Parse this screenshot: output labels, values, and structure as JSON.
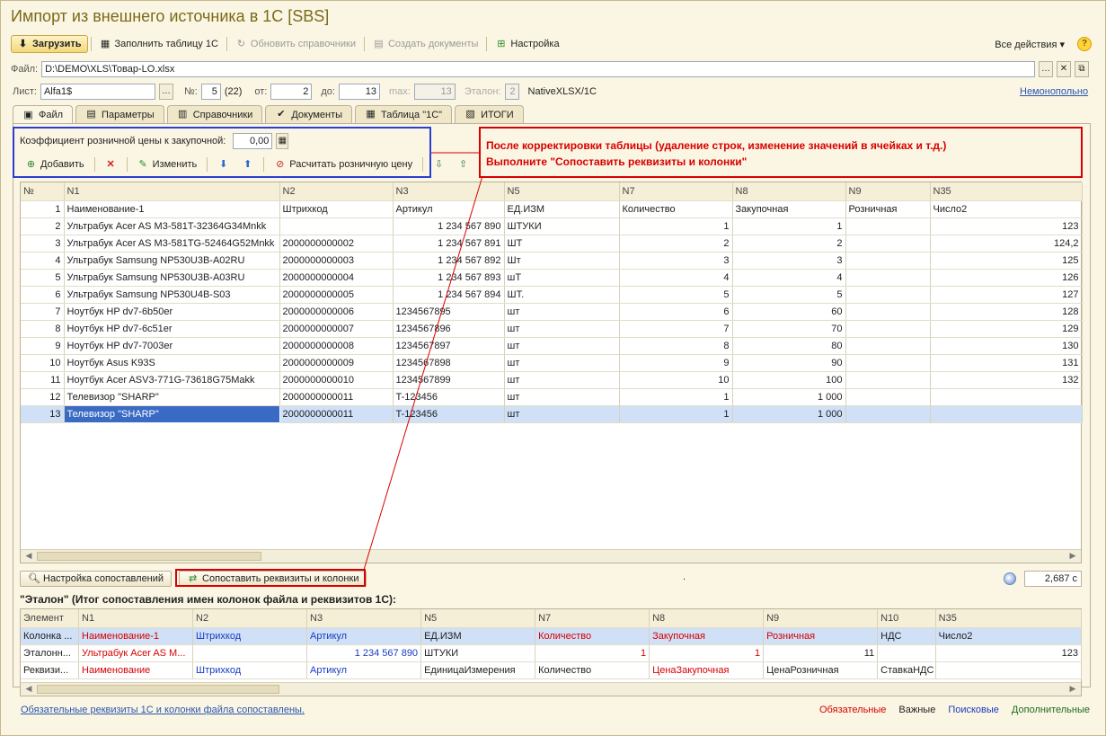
{
  "window": {
    "title": "Импорт из внешнего источника в 1С [SBS]"
  },
  "toolbar": {
    "load": "Загрузить",
    "fill_table": "Заполнить таблицу 1С",
    "update_refs": "Обновить справочники",
    "create_docs": "Создать документы",
    "settings": "Настройка",
    "all_actions": "Все действия ▾"
  },
  "file": {
    "label": "Файл:",
    "path": "D:\\DEMO\\XLS\\Товар-LO.xlsx"
  },
  "sheet": {
    "sheet_label": "Лист:",
    "sheet_value": "Alfa1$",
    "num_label": "№:",
    "num_value": "5",
    "num_total": "(22)",
    "from_label": "от:",
    "from_value": "2",
    "to_label": "до:",
    "to_value": "13",
    "max_label": "max:",
    "max_value": "13",
    "etalon_label": "Эталон:",
    "etalon_value": "2",
    "engine": "NativeXLSX/1C",
    "mode_link": "Немонопольно"
  },
  "tabs": [
    "Файл",
    "Параметры",
    "Справочники",
    "Документы",
    "Таблица \"1С\"",
    "ИТОГИ"
  ],
  "coef": {
    "label": "Коэффициент розничной цены к закупочной:",
    "value": "0,00",
    "add": "Добавить",
    "edit": "Изменить",
    "calc": "Расчитать розничную цену"
  },
  "note": {
    "line1": "После корректировки таблицы (удаление строк, изменение значений в ячейках и т.д.)",
    "line2": "Выполните \"Сопоставить реквизиты и колонки\""
  },
  "main_table": {
    "columns": [
      "№",
      "N1",
      "N2",
      "N3",
      "N5",
      "N7",
      "N8",
      "N9",
      "N35"
    ],
    "rows": [
      [
        "1",
        "Наименование-1",
        "Штрихкод",
        "Артикул",
        "ЕД.ИЗМ",
        "Количество",
        "Закупочная",
        "Розничная",
        "Число2"
      ],
      [
        "2",
        "Ультрабук Acer AS M3-581T-32364G34Mnkk",
        "",
        "1 234 567 890",
        "ШТУКИ",
        "1",
        "1",
        "",
        "123"
      ],
      [
        "3",
        "Ультрабук Acer AS M3-581TG-52464G52Mnkk",
        "2000000000002",
        "1 234 567 891",
        "ШТ",
        "2",
        "2",
        "",
        "124,2"
      ],
      [
        "4",
        "Ультрабук Samsung NP530U3B-A02RU",
        "2000000000003",
        "1 234 567 892",
        "Шт",
        "3",
        "3",
        "",
        "125"
      ],
      [
        "5",
        "Ультрабук Samsung NP530U3B-A03RU",
        "2000000000004",
        "1 234 567 893",
        "шТ",
        "4",
        "4",
        "",
        "126"
      ],
      [
        "6",
        "Ультрабук Samsung NP530U4B-S03",
        "2000000000005",
        "1 234 567 894",
        "ШТ.",
        "5",
        "5",
        "",
        "127"
      ],
      [
        "7",
        "Ноутбук HP dv7-6b50er",
        "2000000000006",
        "1234567895",
        "шт",
        "6",
        "60",
        "",
        "128"
      ],
      [
        "8",
        "Ноутбук HP dv7-6c51er",
        "2000000000007",
        "1234567896",
        "шт",
        "7",
        "70",
        "",
        "129"
      ],
      [
        "9",
        "Ноутбук HP dv7-7003er",
        "2000000000008",
        "1234567897",
        "шт",
        "8",
        "80",
        "",
        "130"
      ],
      [
        "10",
        "Ноутбук Asus K93S",
        "2000000000009",
        "1234567898",
        "шт",
        "9",
        "90",
        "",
        "131"
      ],
      [
        "11",
        "Ноутбук Acer ASV3-771G-73618G75Makk",
        "2000000000010",
        "1234567899",
        "шт",
        "10",
        "100",
        "",
        "132"
      ],
      [
        "12",
        "Телевизор \"SHARP\"",
        "2000000000011",
        "T-123456",
        "шт",
        "1",
        "1 000",
        "",
        ""
      ],
      [
        "13",
        "Телевизор \"SHARP\"",
        "2000000000011",
        "T-123456",
        "шт",
        "1",
        "1 000",
        "",
        ""
      ]
    ]
  },
  "buttons": {
    "match_settings": "Настройка сопоставлений",
    "match_columns": "Сопоставить реквизиты и колонки",
    "dot": ".",
    "time": "2,687 с"
  },
  "etalon": {
    "title": "\"Эталон\" (Итог сопоставления имен колонок файла и реквизитов 1С):",
    "columns": [
      "Элемент",
      "N1",
      "N2",
      "N3",
      "N5",
      "N7",
      "N8",
      "N9",
      "N10",
      "N35"
    ],
    "rows": [
      [
        "Колонка ...",
        "Наименование-1",
        "Штрихкод",
        "Артикул",
        "ЕД.ИЗМ",
        "Количество",
        "Закупочная",
        "Розничная",
        "НДС",
        "Число2"
      ],
      [
        "Эталонн...",
        "Ультрабук Acer AS M...",
        "",
        "1 234 567 890",
        "ШТУКИ",
        "1",
        "1",
        "11",
        "",
        "123"
      ],
      [
        "Реквизи...",
        "Наименование",
        "Штрихкод",
        "Артикул",
        "ЕдиницаИзмерения",
        "Количество",
        "ЦенаЗакупочная",
        "ЦенаРозничная",
        "СтавкаНДС",
        ""
      ]
    ],
    "colors": [
      [
        "black",
        "red",
        "blue",
        "blue",
        "black",
        "red",
        "red",
        "red",
        "black",
        "black"
      ],
      [
        "black",
        "red",
        "blue",
        "blue",
        "black",
        "red",
        "red",
        "black",
        "black",
        "black"
      ],
      [
        "black",
        "red",
        "blue",
        "blue",
        "black",
        "black",
        "red",
        "black",
        "black",
        "black"
      ]
    ]
  },
  "status": {
    "message": "Обязательные реквизиты 1С и колонки файла сопоставлены.",
    "legend_required": "Обязательные",
    "legend_important": "Важные",
    "legend_search": "Поисковые",
    "legend_extra": "Дополнительные"
  },
  "colors": {
    "required": "#d80000",
    "important": "#222222",
    "search": "#1a3cc0",
    "extra": "#1f6b20",
    "selection": "#cfe0f7"
  }
}
